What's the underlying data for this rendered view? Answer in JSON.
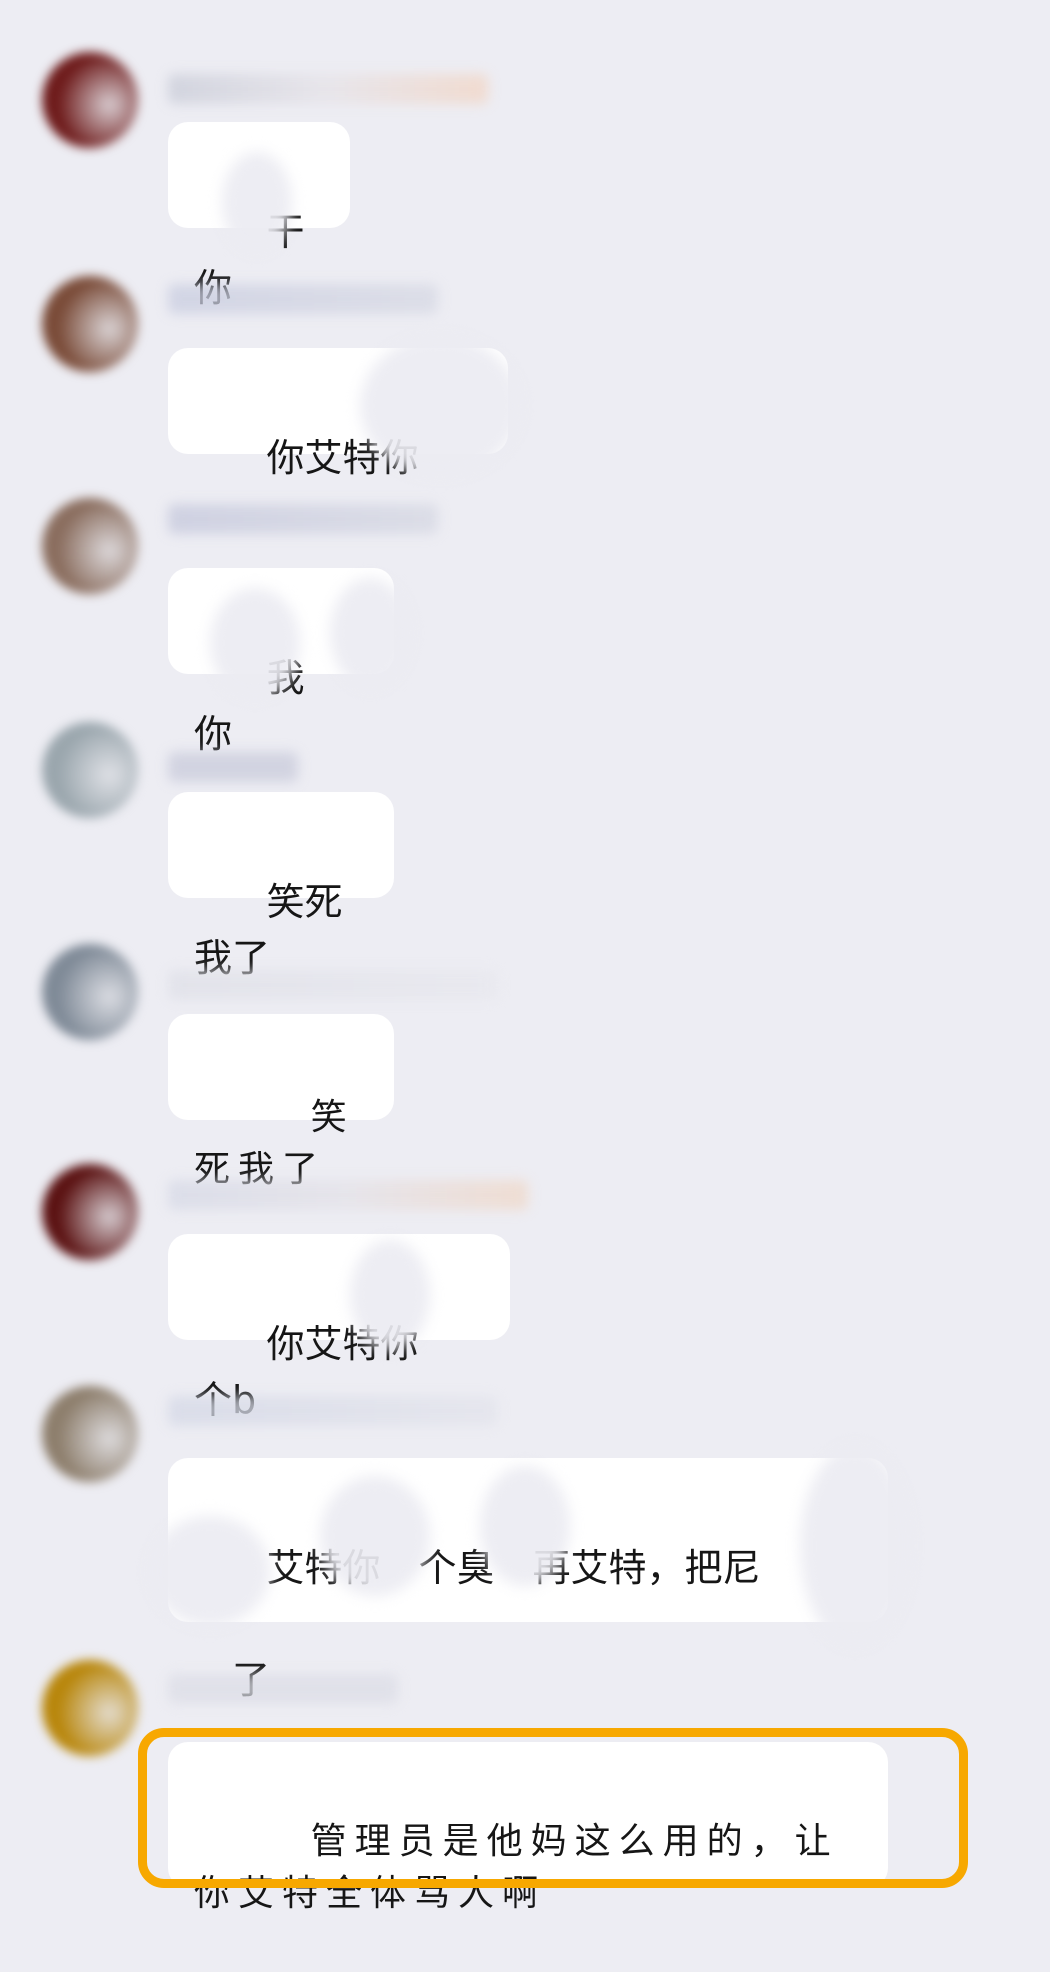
{
  "chat": {
    "messages": [
      {
        "text": "干",
        "text_after": "你",
        "hand": false
      },
      {
        "text": "你艾特你"
      },
      {
        "text": "我",
        "text_after": "你"
      },
      {
        "text": "笑死我了"
      },
      {
        "text": "笑死我了",
        "hand": true
      },
      {
        "text": "你艾特你",
        "text_after": "个b"
      },
      {
        "text": "艾特你",
        "text_mid": "个臭",
        "text_mid2": "再艾特，把尼",
        "text_line2": "了"
      },
      {
        "text": "管理员是他妈这么用的，让你艾特全体骂人啊",
        "hand": true,
        "highlighted": true
      }
    ]
  },
  "colors": {
    "background": "#ededf3",
    "bubble": "#ffffff",
    "highlight_border": "#f7a800"
  }
}
